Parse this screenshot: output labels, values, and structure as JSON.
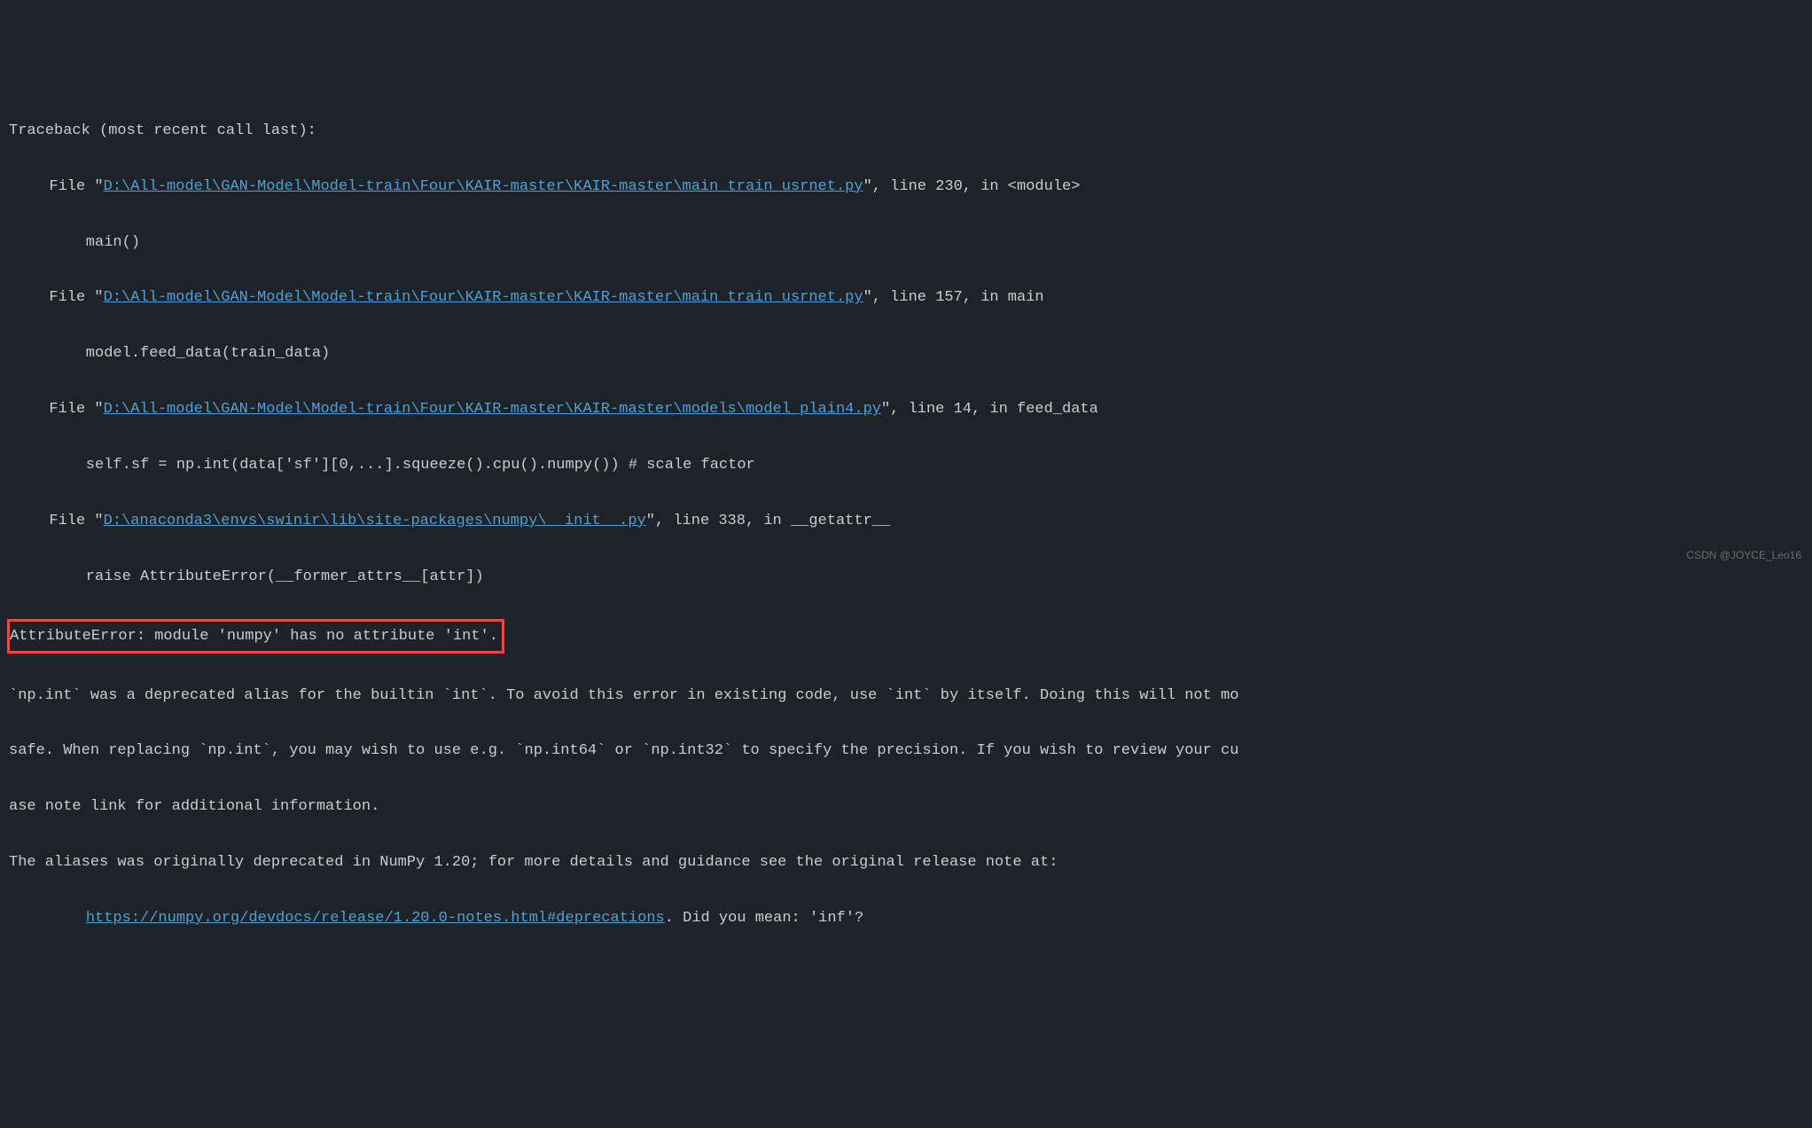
{
  "traceback": {
    "header": "Traceback (most recent call last):",
    "frames": [
      {
        "prefix": "  File \"",
        "path": "D:\\All-model\\GAN-Model\\Model-train\\Four\\KAIR-master\\KAIR-master\\main_train_usrnet.py",
        "suffix": "\", line 230, in <module>",
        "code": "    main()"
      },
      {
        "prefix": "  File \"",
        "path": "D:\\All-model\\GAN-Model\\Model-train\\Four\\KAIR-master\\KAIR-master\\main_train_usrnet.py",
        "suffix": "\", line 157, in main",
        "code": "    model.feed_data(train_data)"
      },
      {
        "prefix": "  File \"",
        "path": "D:\\All-model\\GAN-Model\\Model-train\\Four\\KAIR-master\\KAIR-master\\models\\model_plain4.py",
        "suffix": "\", line 14, in feed_data",
        "code": "    self.sf = np.int(data['sf'][0,...].squeeze().cpu().numpy()) # scale factor"
      },
      {
        "prefix": "  File \"",
        "path": "D:\\anaconda3\\envs\\swinir\\lib\\site-packages\\numpy\\__init__.py",
        "suffix": "\", line 338, in __getattr__",
        "code": "    raise AttributeError(__former_attrs__[attr])"
      }
    ],
    "error_line": "AttributeError: module 'numpy' has no attribute 'int'.",
    "explain1": "`np.int` was a deprecated alias for the builtin `int`. To avoid this error in existing code, use `int` by itself. Doing this will not mo",
    "explain2": "safe. When replacing `np.int`, you may wish to use e.g. `np.int64` or `np.int32` to specify the precision. If you wish to review your cu",
    "explain3": "ase note link for additional information.",
    "explain4": "The aliases was originally deprecated in NumPy 1.20; for more details and guidance see the original release note at:",
    "release_indent": "    ",
    "release_url": "https://numpy.org/devdocs/release/1.20.0-notes.html#deprecations",
    "release_suffix": ". Did you mean: 'inf'?"
  },
  "watermark": "CSDN @JOYCE_Leo16"
}
